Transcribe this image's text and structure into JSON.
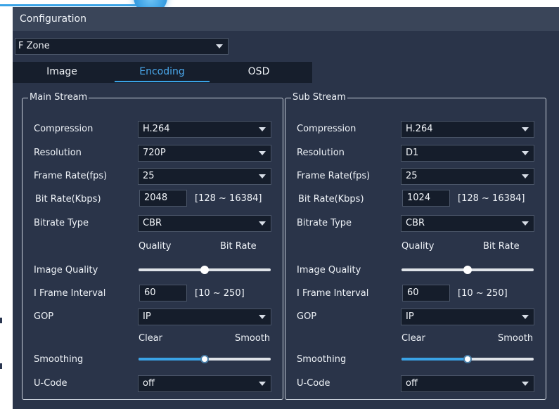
{
  "window": {
    "title": "Configuration"
  },
  "zone_select": {
    "value": "F Zone"
  },
  "tabs": [
    {
      "label": "Image",
      "active": false
    },
    {
      "label": "Encoding",
      "active": true
    },
    {
      "label": "OSD",
      "active": false
    }
  ],
  "labels": {
    "compression": "Compression",
    "resolution": "Resolution",
    "frame_rate": "Frame Rate(fps)",
    "bit_rate": "Bit Rate(Kbps)",
    "bitrate_type": "Bitrate Type",
    "quality": "Quality",
    "bit_rate_cap": "Bit Rate",
    "image_quality": "Image Quality",
    "i_frame_interval": "I Frame Interval",
    "gop": "GOP",
    "clear": "Clear",
    "smooth": "Smooth",
    "smoothing": "Smoothing",
    "u_code": "U-Code"
  },
  "main_stream": {
    "title": "Main Stream",
    "compression": "H.264",
    "resolution": "720P",
    "frame_rate": "25",
    "bit_rate": "2048",
    "bit_rate_range": "[128 ~ 16384]",
    "bitrate_type": "CBR",
    "image_quality_level": 0.5,
    "i_frame_interval": "60",
    "i_frame_range": "[10 ~ 250]",
    "gop": "IP",
    "smoothing_level": 0.5,
    "u_code": "off"
  },
  "sub_stream": {
    "title": "Sub Stream",
    "compression": "H.264",
    "resolution": "D1",
    "frame_rate": "25",
    "bit_rate": "1024",
    "bit_rate_range": "[128 ~ 16384]",
    "bitrate_type": "CBR",
    "image_quality_level": 0.5,
    "i_frame_interval": "60",
    "i_frame_range": "[10 ~ 250]",
    "gop": "IP",
    "smoothing_level": 0.5,
    "u_code": "off"
  },
  "colors": {
    "accent": "#3aa3e6",
    "panel_bg": "#2a3449",
    "titlebar_bg": "#3a4559",
    "field_bg": "#151d2b"
  }
}
